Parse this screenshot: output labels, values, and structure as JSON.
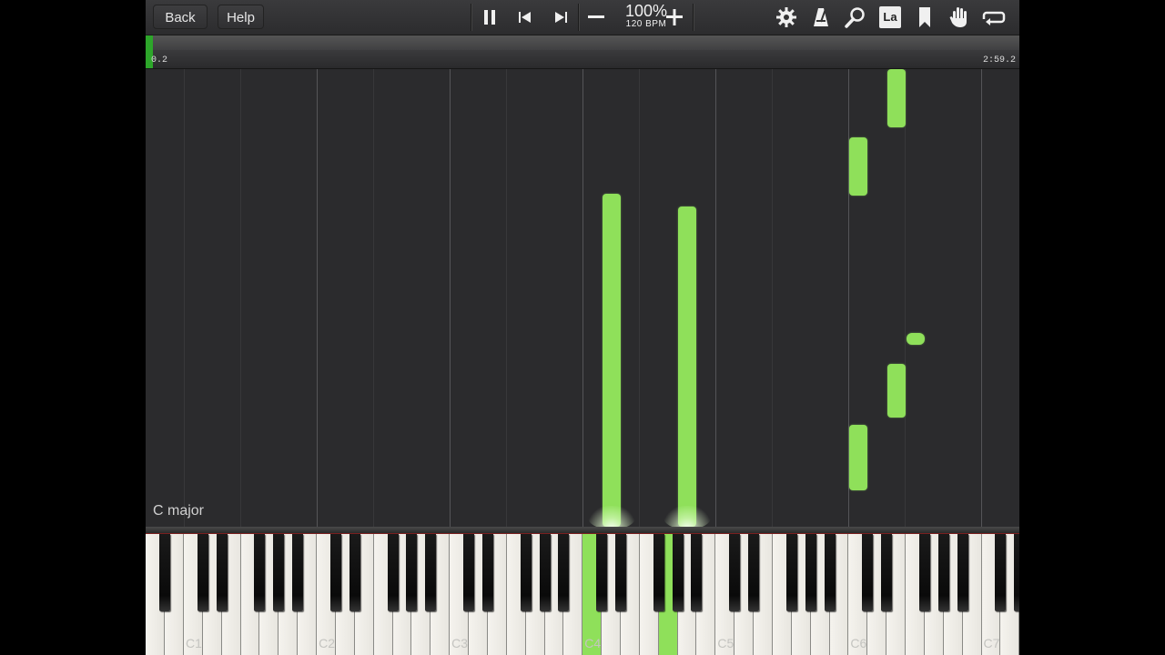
{
  "toolbar": {
    "back_label": "Back",
    "help_label": "Help",
    "speed": "100%",
    "bpm": "120 BPM",
    "icons": [
      "pause-icon",
      "skip-back-icon",
      "skip-forward-icon",
      "minus-icon",
      "plus-icon",
      "gear-icon",
      "metronome-icon",
      "magnifier-icon",
      "note-labels-icon",
      "bookmark-icon",
      "hand-icon",
      "loop-icon"
    ],
    "note_labels_text": "La"
  },
  "progress": {
    "current_time": "0.2",
    "end_time": "2:59.2",
    "fraction": 0.006
  },
  "roll": {
    "key_signature": "C major"
  },
  "keyboard": {
    "octave_labels": [
      "C1",
      "C2",
      "C3",
      "C4",
      "C5",
      "C6",
      "C7"
    ],
    "lit_keys": [
      "C4",
      "G4"
    ]
  },
  "colors": {
    "note": "#8fe05a",
    "progress": "#2da62a",
    "background": "#2b2b2d"
  }
}
